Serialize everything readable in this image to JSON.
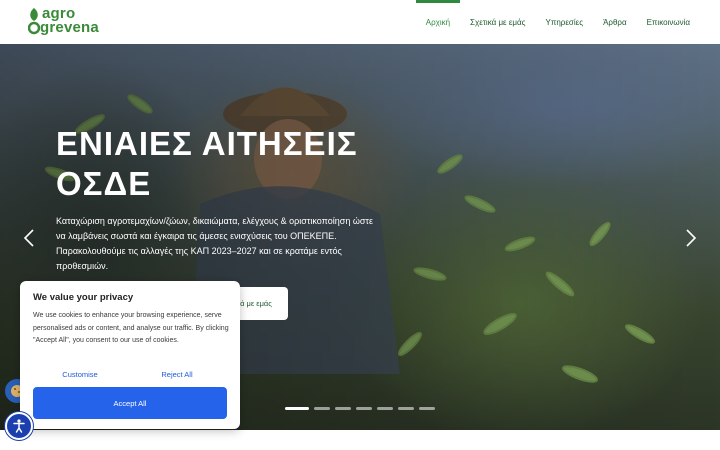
{
  "header": {
    "logo": {
      "line1": "agro",
      "line2": "grevena"
    },
    "nav": [
      {
        "label": "Αρχική",
        "active": true
      },
      {
        "label": "Σχετικά με εμάς",
        "active": false
      },
      {
        "label": "Υπηρεσίες",
        "active": false
      },
      {
        "label": "Άρθρα",
        "active": false
      },
      {
        "label": "Επικοινωνία",
        "active": false
      }
    ]
  },
  "hero": {
    "title": "ΕΝΙΑΙΕΣ ΑΙΤΗΣΕΙΣ ΟΣΔΕ",
    "description": "Καταχώριση αγροτεμαχίων/ζώων, δικαιώματα, ελέγχους & οριστικοποίηση ώστε να λαμβάνεις σωστά και έγκαιρα τις άμεσες ενισχύσεις του ΟΠΕΚΕΠΕ. Παρακολουθούμε τις αλλαγές της ΚΑΠ 2023–2027 και σε κρατάμε εντός προθεσμιών.",
    "button_label": "ά με εμάς",
    "slides_total": 7,
    "slide_active": 1
  },
  "cookie": {
    "title": "We value your privacy",
    "text": "We use cookies to enhance your browsing experience, serve personalised ads or content, and analyse our traffic. By clicking \"Accept All\", you consent to our use of cookies.",
    "customise_label": "Customise",
    "reject_label": "Reject All",
    "accept_label": "Accept All"
  },
  "icons": {
    "prev": "chevron-left-icon",
    "next": "chevron-right-icon",
    "accessibility": "accessibility-icon",
    "cookie_settings": "cookie-icon"
  },
  "colors": {
    "brand_green": "#3a8a3a",
    "nav_text": "#1e5a2e",
    "accept_blue": "#2563eb",
    "link_blue": "#1f5bd6"
  }
}
